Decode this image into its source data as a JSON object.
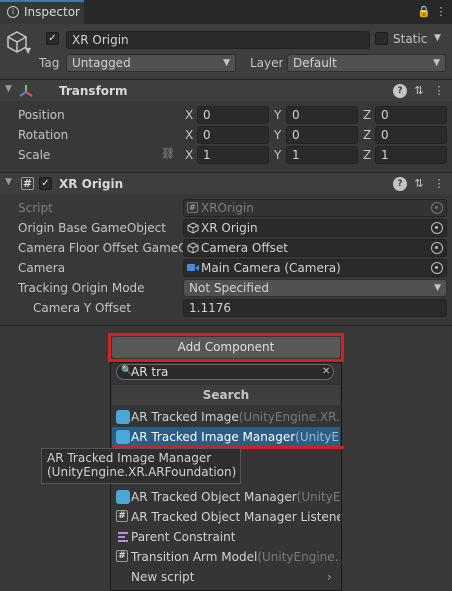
{
  "tab": {
    "title": "Inspector"
  },
  "object": {
    "name": "XR Origin",
    "static_label": "Static",
    "tag_label": "Tag",
    "tag_value": "Untagged",
    "layer_label": "Layer",
    "layer_value": "Default"
  },
  "transform": {
    "title": "Transform",
    "rows": [
      {
        "label": "Position",
        "x": "0",
        "y": "0",
        "z": "0"
      },
      {
        "label": "Rotation",
        "x": "0",
        "y": "0",
        "z": "0"
      },
      {
        "label": "Scale",
        "x": "1",
        "y": "1",
        "z": "1"
      }
    ],
    "axis_x": "X",
    "axis_y": "Y",
    "axis_z": "Z"
  },
  "xr_origin": {
    "title": "XR Origin",
    "script_label": "Script",
    "script_value": "XROrigin",
    "base_label": "Origin Base GameObject",
    "base_value": "XR Origin",
    "floor_label": "Camera Floor Offset GameOb",
    "floor_value": "Camera Offset",
    "camera_label": "Camera",
    "camera_value": "Main Camera (Camera)",
    "tracking_label": "Tracking Origin Mode",
    "tracking_value": "Not Specified",
    "camy_label": "Camera Y Offset",
    "camy_value": "1.1176"
  },
  "add_component": {
    "label": "Add Component"
  },
  "popup": {
    "search_value": "AR tra",
    "section_title": "Search",
    "items": [
      {
        "name": "AR Tracked Image",
        "ns": "(UnityEngine.XR.AR"
      },
      {
        "name": "AR Tracked Image Manager",
        "ns": "(UnityEng"
      },
      {
        "name": "AR Tracked Object Manager",
        "ns": "(UnityEng"
      },
      {
        "name": "AR Tracked Object Manager Listener",
        "ns": ""
      },
      {
        "name": "Parent Constraint",
        "ns": ""
      },
      {
        "name": "Transition Arm Model",
        "ns": "(UnityEngine.XR"
      },
      {
        "name": "New script",
        "ns": ""
      }
    ]
  },
  "tooltip": {
    "line1": "AR Tracked Image Manager",
    "line2": "(UnityEngine.XR.ARFoundation)"
  },
  "colors": {
    "highlight": "#2c5d87",
    "red_outline": "#d0202a",
    "accent_blue": "#4aa8d8"
  }
}
